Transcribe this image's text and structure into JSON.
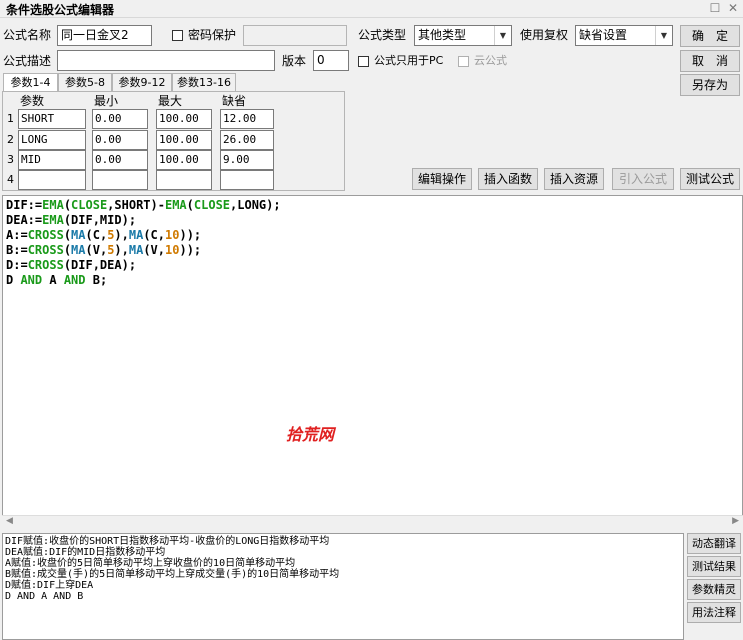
{
  "window": {
    "title": "条件选股公式编辑器"
  },
  "form": {
    "name_label": "公式名称",
    "name_value": "同一日金叉2",
    "password_label": "密码保护",
    "type_label": "公式类型",
    "type_value": "其他类型",
    "fuquan_label": "使用复权",
    "fuquan_value": "缺省设置",
    "desc_label": "公式描述",
    "desc_value": "",
    "version_label": "版本",
    "version_value": "0",
    "pc_only_label": "公式只用于PC",
    "cloud_label": "云公式"
  },
  "buttons": {
    "ok": "确　定",
    "cancel": "取　消",
    "save_as": "另存为",
    "edit_ops": "编辑操作",
    "insert_func": "插入函数",
    "insert_res": "插入资源",
    "import_formula": "引入公式",
    "test_formula": "测试公式"
  },
  "tabs": [
    "参数1-4",
    "参数5-8",
    "参数9-12",
    "参数13-16"
  ],
  "params": {
    "headers": [
      "参数",
      "最小",
      "最大",
      "缺省"
    ],
    "rows": [
      {
        "num": "1",
        "name": "SHORT",
        "min": "0.00",
        "max": "100.00",
        "default": "12.00"
      },
      {
        "num": "2",
        "name": "LONG",
        "min": "0.00",
        "max": "100.00",
        "default": "26.00"
      },
      {
        "num": "3",
        "name": "MID",
        "min": "0.00",
        "max": "100.00",
        "default": "9.00"
      },
      {
        "num": "4",
        "name": "",
        "min": "",
        "max": "",
        "default": ""
      }
    ]
  },
  "code": {
    "line1": {
      "a": "DIF:=",
      "b": "EMA",
      "c": "(",
      "d": "CLOSE",
      "e": ",SHORT)-",
      "f": "EMA",
      "g": "(",
      "h": "CLOSE",
      "i": ",LONG);"
    },
    "line2": {
      "a": "DEA:=",
      "b": "EMA",
      "c": "(DIF,MID);"
    },
    "line3": {
      "a": "A:=",
      "b": "CROSS",
      "c": "(",
      "d": "MA",
      "e": "(C,",
      "f": "5",
      "g": "),",
      "h": "MA",
      "i": "(C,",
      "j": "10",
      "k": "));"
    },
    "line4": {
      "a": "B:=",
      "b": "CROSS",
      "c": "(",
      "d": "MA",
      "e": "(V,",
      "f": "5",
      "g": "),",
      "h": "MA",
      "i": "(V,",
      "j": "10",
      "k": "));"
    },
    "line5": {
      "a": "D:=",
      "b": "CROSS",
      "c": "(DIF,DEA);"
    },
    "line6": {
      "a": "D ",
      "b": "AND",
      "c": " A ",
      "d": "AND",
      "e": " B;"
    }
  },
  "watermark": "拾荒网",
  "explanation": [
    "DIF赋值:收盘价的SHORT日指数移动平均-收盘价的LONG日指数移动平均",
    "DEA赋值:DIF的MID日指数移动平均",
    "A赋值:收盘价的5日简单移动平均上穿收盘价的10日简单移动平均",
    "B赋值:成交量(手)的5日简单移动平均上穿成交量(手)的10日简单移动平均",
    "D赋值:DIF上穿DEA",
    "D AND A AND B"
  ],
  "side_buttons": {
    "dynamic_translate": "动态翻译",
    "test_result": "测试结果",
    "param_wizard": "参数精灵",
    "usage_notes": "用法注释"
  },
  "colors": {
    "function": "#1a9a1a",
    "variable": "#1a7aa8",
    "number": "#d07a00",
    "watermark": "#e02020"
  }
}
